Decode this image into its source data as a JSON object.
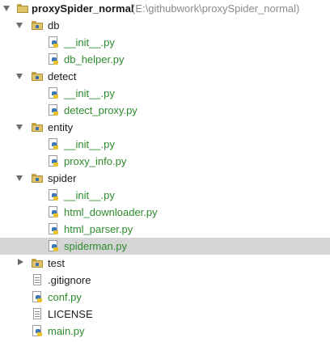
{
  "project": {
    "name": "proxySpider_normal",
    "path": "(E:\\githubwork\\proxySpider_normal)"
  },
  "tree": {
    "db": {
      "label": "db",
      "files": [
        "__init__.py",
        "db_helper.py"
      ]
    },
    "detect": {
      "label": "detect",
      "files": [
        "__init__.py",
        "detect_proxy.py"
      ]
    },
    "entity": {
      "label": "entity",
      "files": [
        "__init__.py",
        "proxy_info.py"
      ]
    },
    "spider": {
      "label": "spider",
      "files": [
        "__init__.py",
        "html_downloader.py",
        "html_parser.py",
        "spiderman.py"
      ]
    },
    "test": {
      "label": "test"
    },
    "root_files": [
      ".gitignore",
      "conf.py",
      "LICENSE",
      "main.py"
    ]
  },
  "colors": {
    "python_file_text": "#2c8a2c",
    "selected_row": "#d5d5d5",
    "folder": "#e0c36b"
  },
  "icons": {
    "folder": "package-folder-icon",
    "python": "python-file-icon",
    "text": "text-file-icon"
  }
}
